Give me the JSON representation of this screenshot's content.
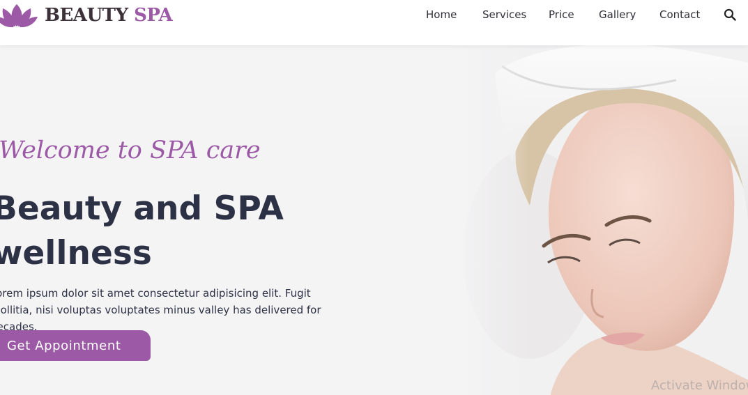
{
  "header": {
    "brand_part1": "BEAUTY",
    "brand_part2": "SPA",
    "nav": [
      "Home",
      "Services",
      "Price",
      "Gallery",
      "Contact"
    ]
  },
  "hero": {
    "welcome": "Welcome to SPA care",
    "title_line1": "Beauty and SPA",
    "title_line2": "wellness",
    "description": "Lorem ipsum dolor sit amet consectetur adipisicing elit. Fugit mollitia, nisi voluptas voluptates minus valley has delivered for decades.",
    "cta_label": "Get Appointment"
  },
  "watermark": "Activate Windows",
  "icons": {
    "logo": "lotus-icon",
    "search": "search-icon"
  },
  "colors": {
    "accent": "#9b59a6",
    "dark_text": "#2d3145",
    "brand_dark": "#3c3138",
    "background": "#f4f4f5"
  }
}
